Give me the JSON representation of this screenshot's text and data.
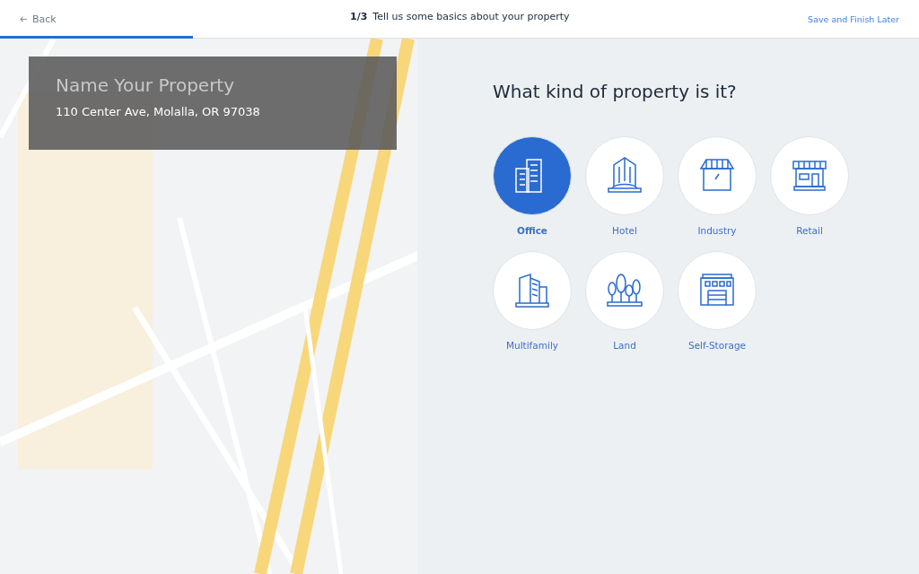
{
  "header": {
    "back": "Back",
    "step": "1/3",
    "title": "Tell us some basics about your property",
    "save": "Save and Finish Later",
    "progress": {
      "level": 0.21
    }
  },
  "property_card": {
    "name_placeholder": "Name Your Property",
    "address": "110 Center Ave, Molalla, OR 97038"
  },
  "question": "What kind of property is it?",
  "options": [
    {
      "kind": "office",
      "label": "Office",
      "selected": true
    },
    {
      "kind": "hotel",
      "label": "Hotel",
      "selected": false
    },
    {
      "kind": "industry",
      "label": "Industry",
      "selected": false
    },
    {
      "kind": "retail",
      "label": "Retail",
      "selected": false
    },
    {
      "kind": "multifamily",
      "label": "Multifamily",
      "selected": false
    },
    {
      "kind": "land",
      "label": "Land",
      "selected": false
    },
    {
      "kind": "storage",
      "label": "Self-Storage",
      "selected": false
    }
  ]
}
